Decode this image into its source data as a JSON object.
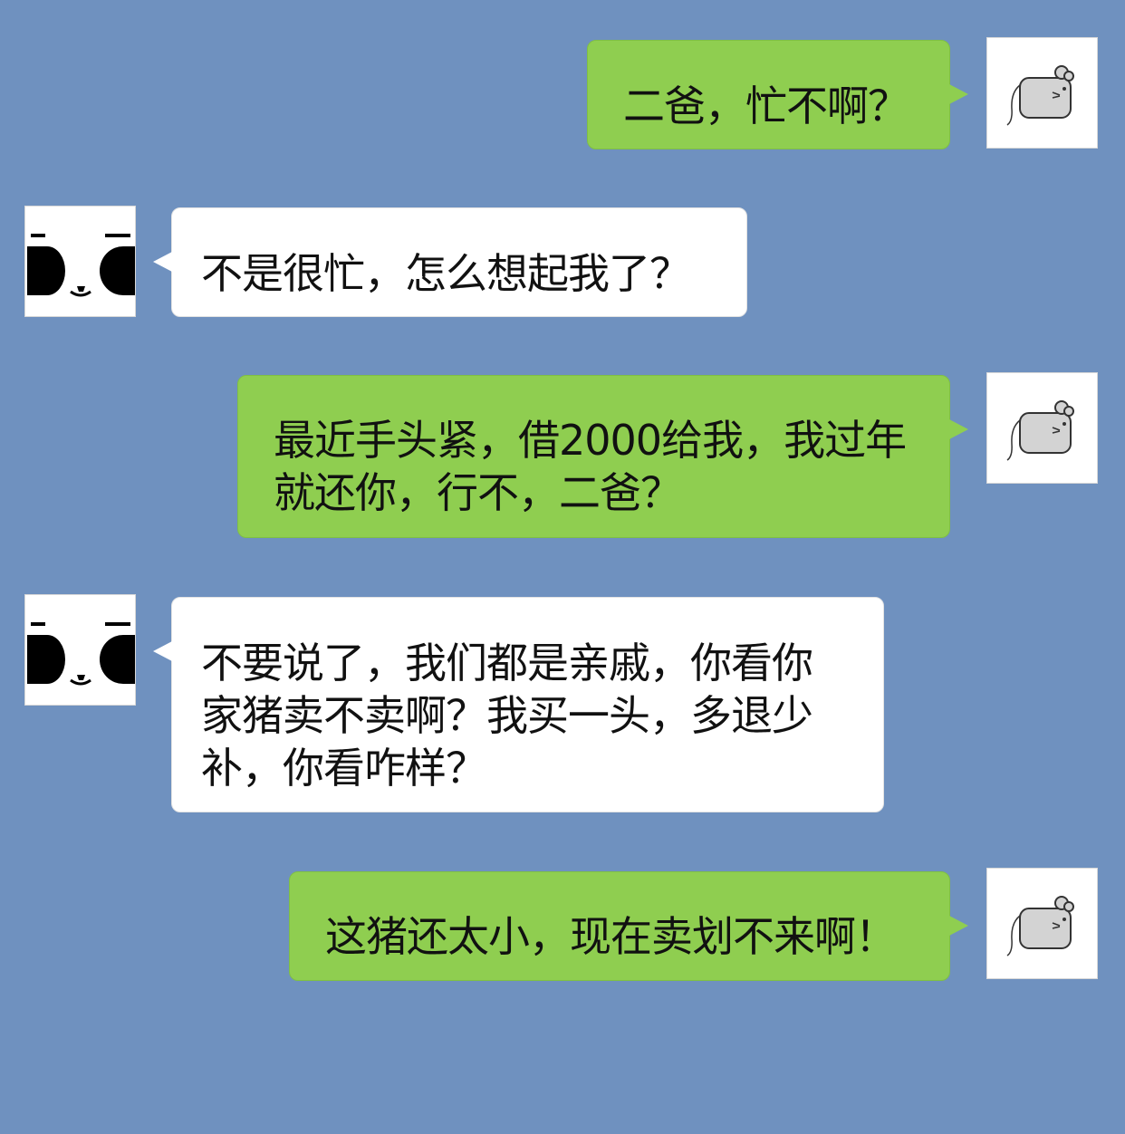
{
  "chat": {
    "messages": [
      {
        "id": "m1",
        "direction": "outgoing",
        "text": "二爸，忙不啊？",
        "avatar_icon": "mouse-icon"
      },
      {
        "id": "m2",
        "direction": "incoming",
        "text": "不是很忙，怎么想起我了？",
        "avatar_icon": "panda-face-icon"
      },
      {
        "id": "m3",
        "direction": "outgoing",
        "text": "最近手头紧，借2000给我，我过年\n就还你，行不，二爸？",
        "avatar_icon": "mouse-icon"
      },
      {
        "id": "m4",
        "direction": "incoming",
        "text": "不要说了，我们都是亲戚，你看你\n家猪卖不卖啊？我买一头，多退少\n补，你看咋样？",
        "avatar_icon": "panda-face-icon"
      },
      {
        "id": "m5",
        "direction": "outgoing",
        "text": "这猪还太小，现在卖划不来啊！",
        "avatar_icon": "mouse-icon"
      }
    ]
  },
  "colors": {
    "background": "#6f91bf",
    "outgoing_bubble": "#8fce50",
    "incoming_bubble": "#ffffff",
    "text": "#111111"
  }
}
